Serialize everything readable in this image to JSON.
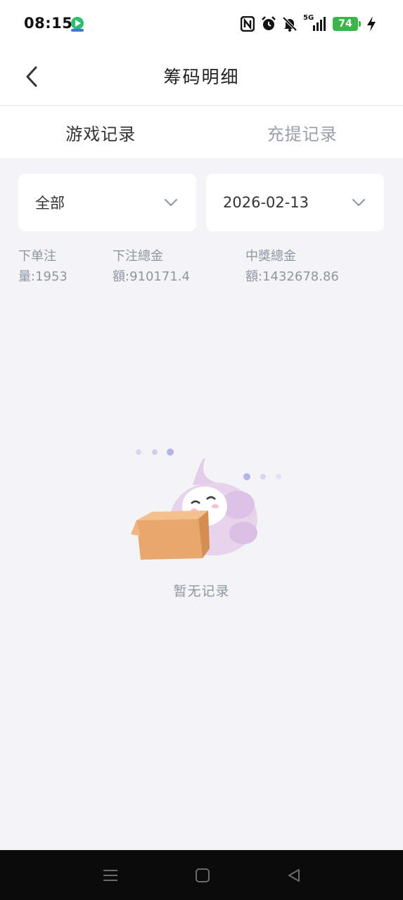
{
  "status_bar": {
    "time": "08:15",
    "network": "5G",
    "battery": "74",
    "icons": [
      "nfc-icon",
      "alarm-icon",
      "mute-icon",
      "signal-icon",
      "battery-icon",
      "charging-icon"
    ]
  },
  "header": {
    "title": "筹码明细",
    "back_icon": "back-arrow-icon"
  },
  "tabs": [
    {
      "label": "游戏记录",
      "active": true
    },
    {
      "label": "充提记录",
      "active": false
    }
  ],
  "filters": {
    "category": {
      "value": "全部",
      "icon": "chevron-down-icon"
    },
    "date": {
      "value": "2026-02-13",
      "icon": "chevron-down-icon"
    }
  },
  "stats": {
    "order_count": "下单注量:1953",
    "bet_total": "下注總金額:910171.4",
    "win_total": "中獎總金額:1432678.86"
  },
  "empty_state": {
    "text": "暂无记录",
    "illustration": "empty-box-mascot"
  },
  "nav_bar": {
    "icons": [
      "menu-icon",
      "home-icon",
      "back-icon"
    ]
  },
  "colors": {
    "background": "#f4f4f6",
    "card": "#ffffff",
    "muted_text": "#8e96a4",
    "battery_green": "#39b54a"
  }
}
